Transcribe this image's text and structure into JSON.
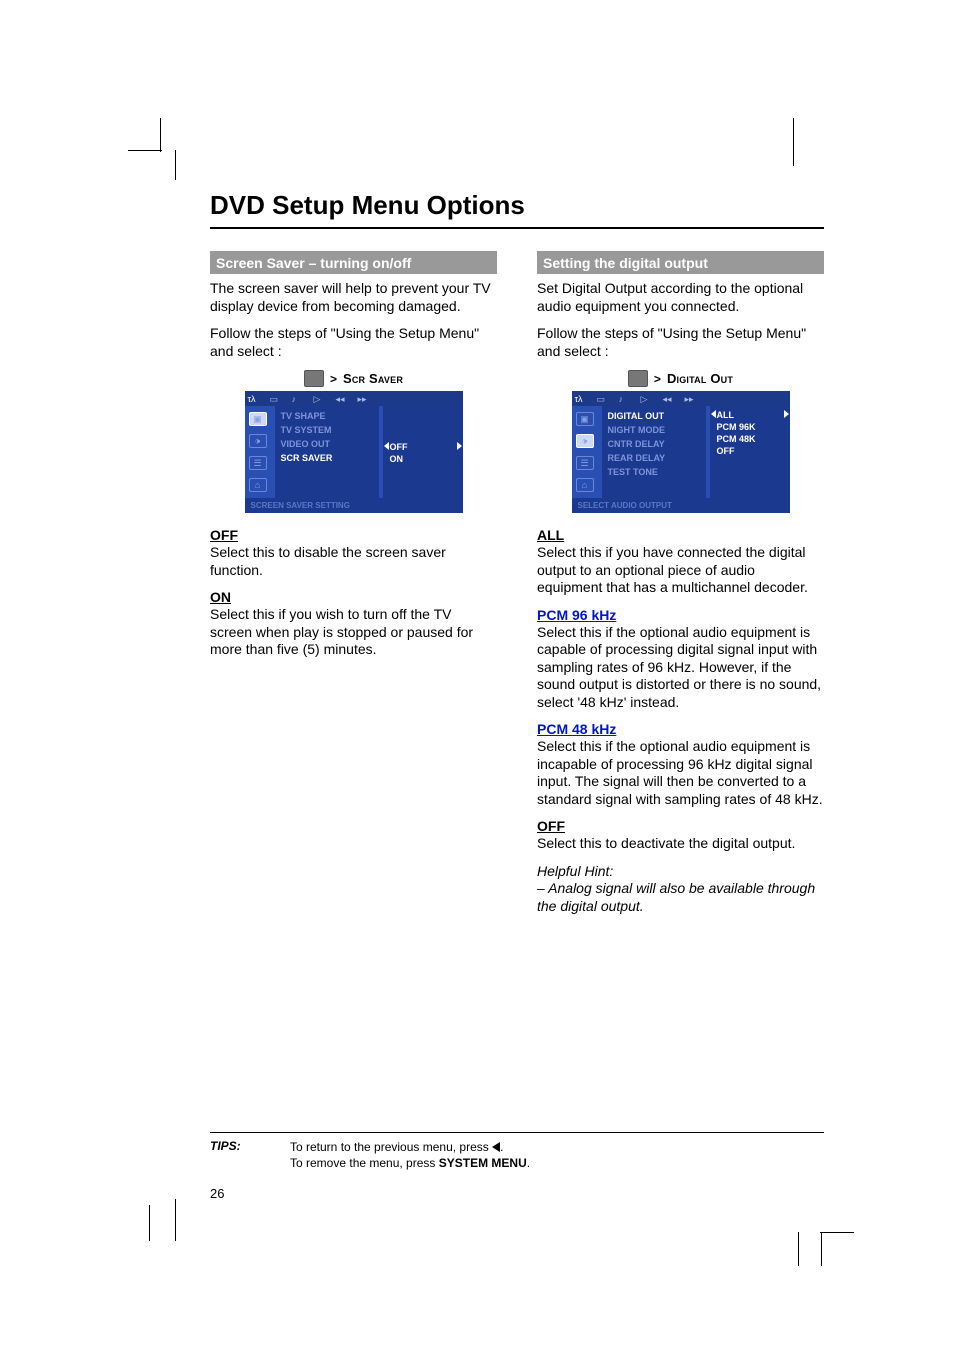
{
  "title": "DVD Setup Menu Options",
  "page_number": "26",
  "left": {
    "section_title": "Screen Saver – turning on/off",
    "intro1": "The screen saver will help to prevent your TV display device from becoming damaged.",
    "intro2": "Follow the steps of \"Using the Setup Menu\" and select :",
    "breadcrumb_label": "Scr Saver",
    "menu": {
      "items": [
        "TV SHAPE",
        "TV SYSTEM",
        "VIDEO OUT",
        "SCR SAVER"
      ],
      "selected_index": 3,
      "options": [
        "OFF",
        "ON"
      ],
      "selected_option_index": 0,
      "footer": "SCREEN SAVER SETTING"
    },
    "options": [
      {
        "title": "OFF",
        "link": false,
        "body": "Select this to disable the screen saver function."
      },
      {
        "title": "ON",
        "link": false,
        "body": "Select this if you wish to turn off the TV screen when play is stopped or paused for more than five (5) minutes."
      }
    ]
  },
  "right": {
    "section_title": "Setting the digital output",
    "intro1": "Set Digital Output according to the optional audio equipment you connected.",
    "intro2": "Follow the steps of \"Using the Setup Menu\" and select :",
    "breadcrumb_label": "Digital Out",
    "menu": {
      "items": [
        "DIGITAL OUT",
        "NIGHT MODE",
        "CNTR DELAY",
        "REAR DELAY",
        "TEST TONE"
      ],
      "selected_index": 0,
      "options": [
        "ALL",
        "PCM 96K",
        "PCM 48K",
        "OFF"
      ],
      "selected_option_index": 0,
      "footer": "SELECT AUDIO OUTPUT"
    },
    "options": [
      {
        "title": "ALL",
        "link": false,
        "body": "Select this if you have connected the digital output to an optional piece of audio equipment that has a multichannel decoder."
      },
      {
        "title": "PCM 96 kHz",
        "link": true,
        "body": "Select this if the optional audio equipment is capable of processing digital signal input with sampling rates of 96 kHz. However, if the sound output is distorted or there is no sound, select '48 kHz' instead."
      },
      {
        "title": "PCM 48 kHz",
        "link": true,
        "body": "Select this if the optional audio equipment is incapable of processing 96 kHz digital signal input.  The signal will then be converted to a standard signal with sampling rates of 48 kHz."
      },
      {
        "title": "OFF",
        "link": false,
        "body": "Select this to deactivate the digital output."
      }
    ],
    "hint_label": "Helpful Hint:",
    "hint_body": "–  Analog signal will also be available through the digital output."
  },
  "tips": {
    "label": "TIPS:",
    "line1_pre": "To return to the previous menu, press ",
    "line1_post": ".",
    "line2_pre": "To remove the menu, press ",
    "line2_bold": "SYSTEM MENU",
    "line2_post": "."
  }
}
